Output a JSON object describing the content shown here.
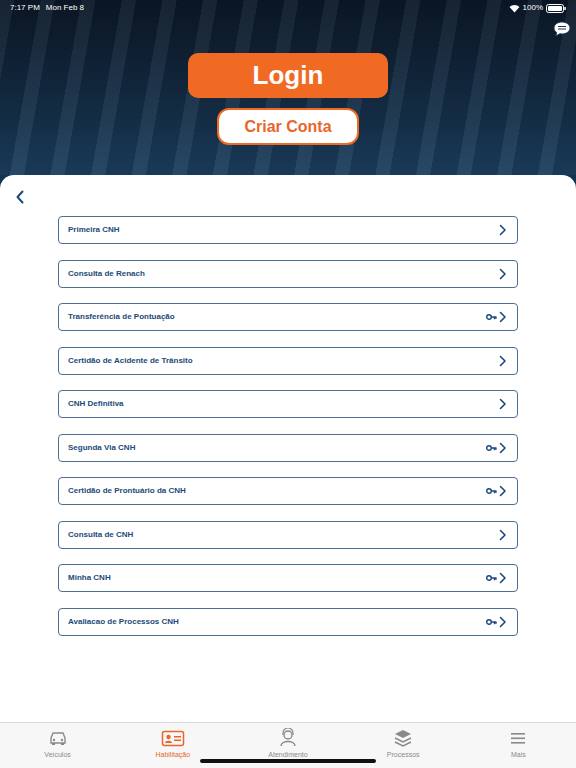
{
  "status_bar": {
    "time": "7:17 PM",
    "date": "Mon Feb 8",
    "battery": "100%"
  },
  "buttons": {
    "login": "Login",
    "create_account": "Criar Conta"
  },
  "menu": [
    {
      "label": "Primeira CNH",
      "requires_login": false
    },
    {
      "label": "Consulta de Renach",
      "requires_login": false
    },
    {
      "label": "Transferência de Pontuação",
      "requires_login": true
    },
    {
      "label": "Certidão de Acidente de Trânsito",
      "requires_login": false
    },
    {
      "label": "CNH Definitiva",
      "requires_login": false
    },
    {
      "label": "Segunda Via CNH",
      "requires_login": true
    },
    {
      "label": "Certidão de Prontuário da CNH",
      "requires_login": true
    },
    {
      "label": "Consulta de CNH",
      "requires_login": false
    },
    {
      "label": "Minha CNH",
      "requires_login": true
    },
    {
      "label": "Avaliacao de Processos CNH",
      "requires_login": true
    }
  ],
  "tabs": [
    {
      "label": "Veículos",
      "selected": false
    },
    {
      "label": "Habilitação",
      "selected": true
    },
    {
      "label": "Atendimento",
      "selected": false
    },
    {
      "label": "Processos",
      "selected": false
    },
    {
      "label": "Mais",
      "selected": false
    }
  ]
}
